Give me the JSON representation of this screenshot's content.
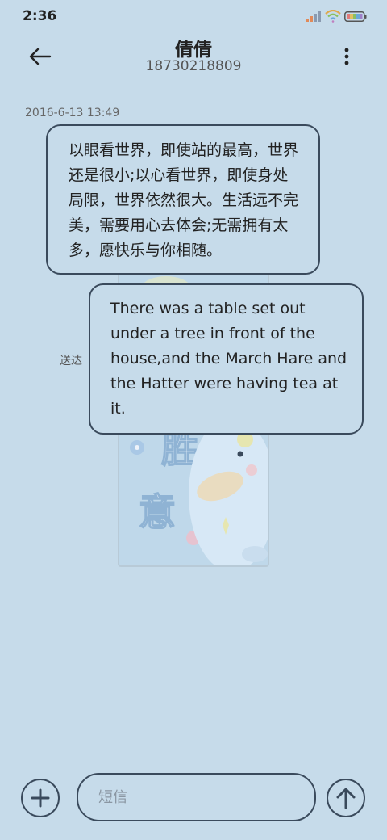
{
  "status_bar": {
    "time": "2:36"
  },
  "header": {
    "contact_name": "倩倩",
    "contact_number": "18730218809",
    "back_icon": "back-arrow-icon",
    "more_icon": "more-vertical-icon"
  },
  "conversation": {
    "timestamp": "2016-6-13 13:49",
    "messages": [
      {
        "direction": "received",
        "text": "以眼看世界，即使站的最高，世界还是很小;以心看世界，即使身处局限，世界依然很大。生活远不完美，需要用心去体会;无需拥有太多，愿快乐与你相随。"
      },
      {
        "direction": "sent",
        "text": "There was a table set out under a tree in front of the house,and the March Hare and the Hatter were having tea at it.",
        "status": "送达"
      }
    ],
    "sticker": {
      "lettering": "胜意"
    }
  },
  "composer": {
    "placeholder": "短信",
    "value": "",
    "add_icon": "plus-icon",
    "send_icon": "send-arrow-icon"
  },
  "colors": {
    "background": "#c6dbea",
    "bubble_border": "#3a4a5c",
    "text": "#222222"
  }
}
